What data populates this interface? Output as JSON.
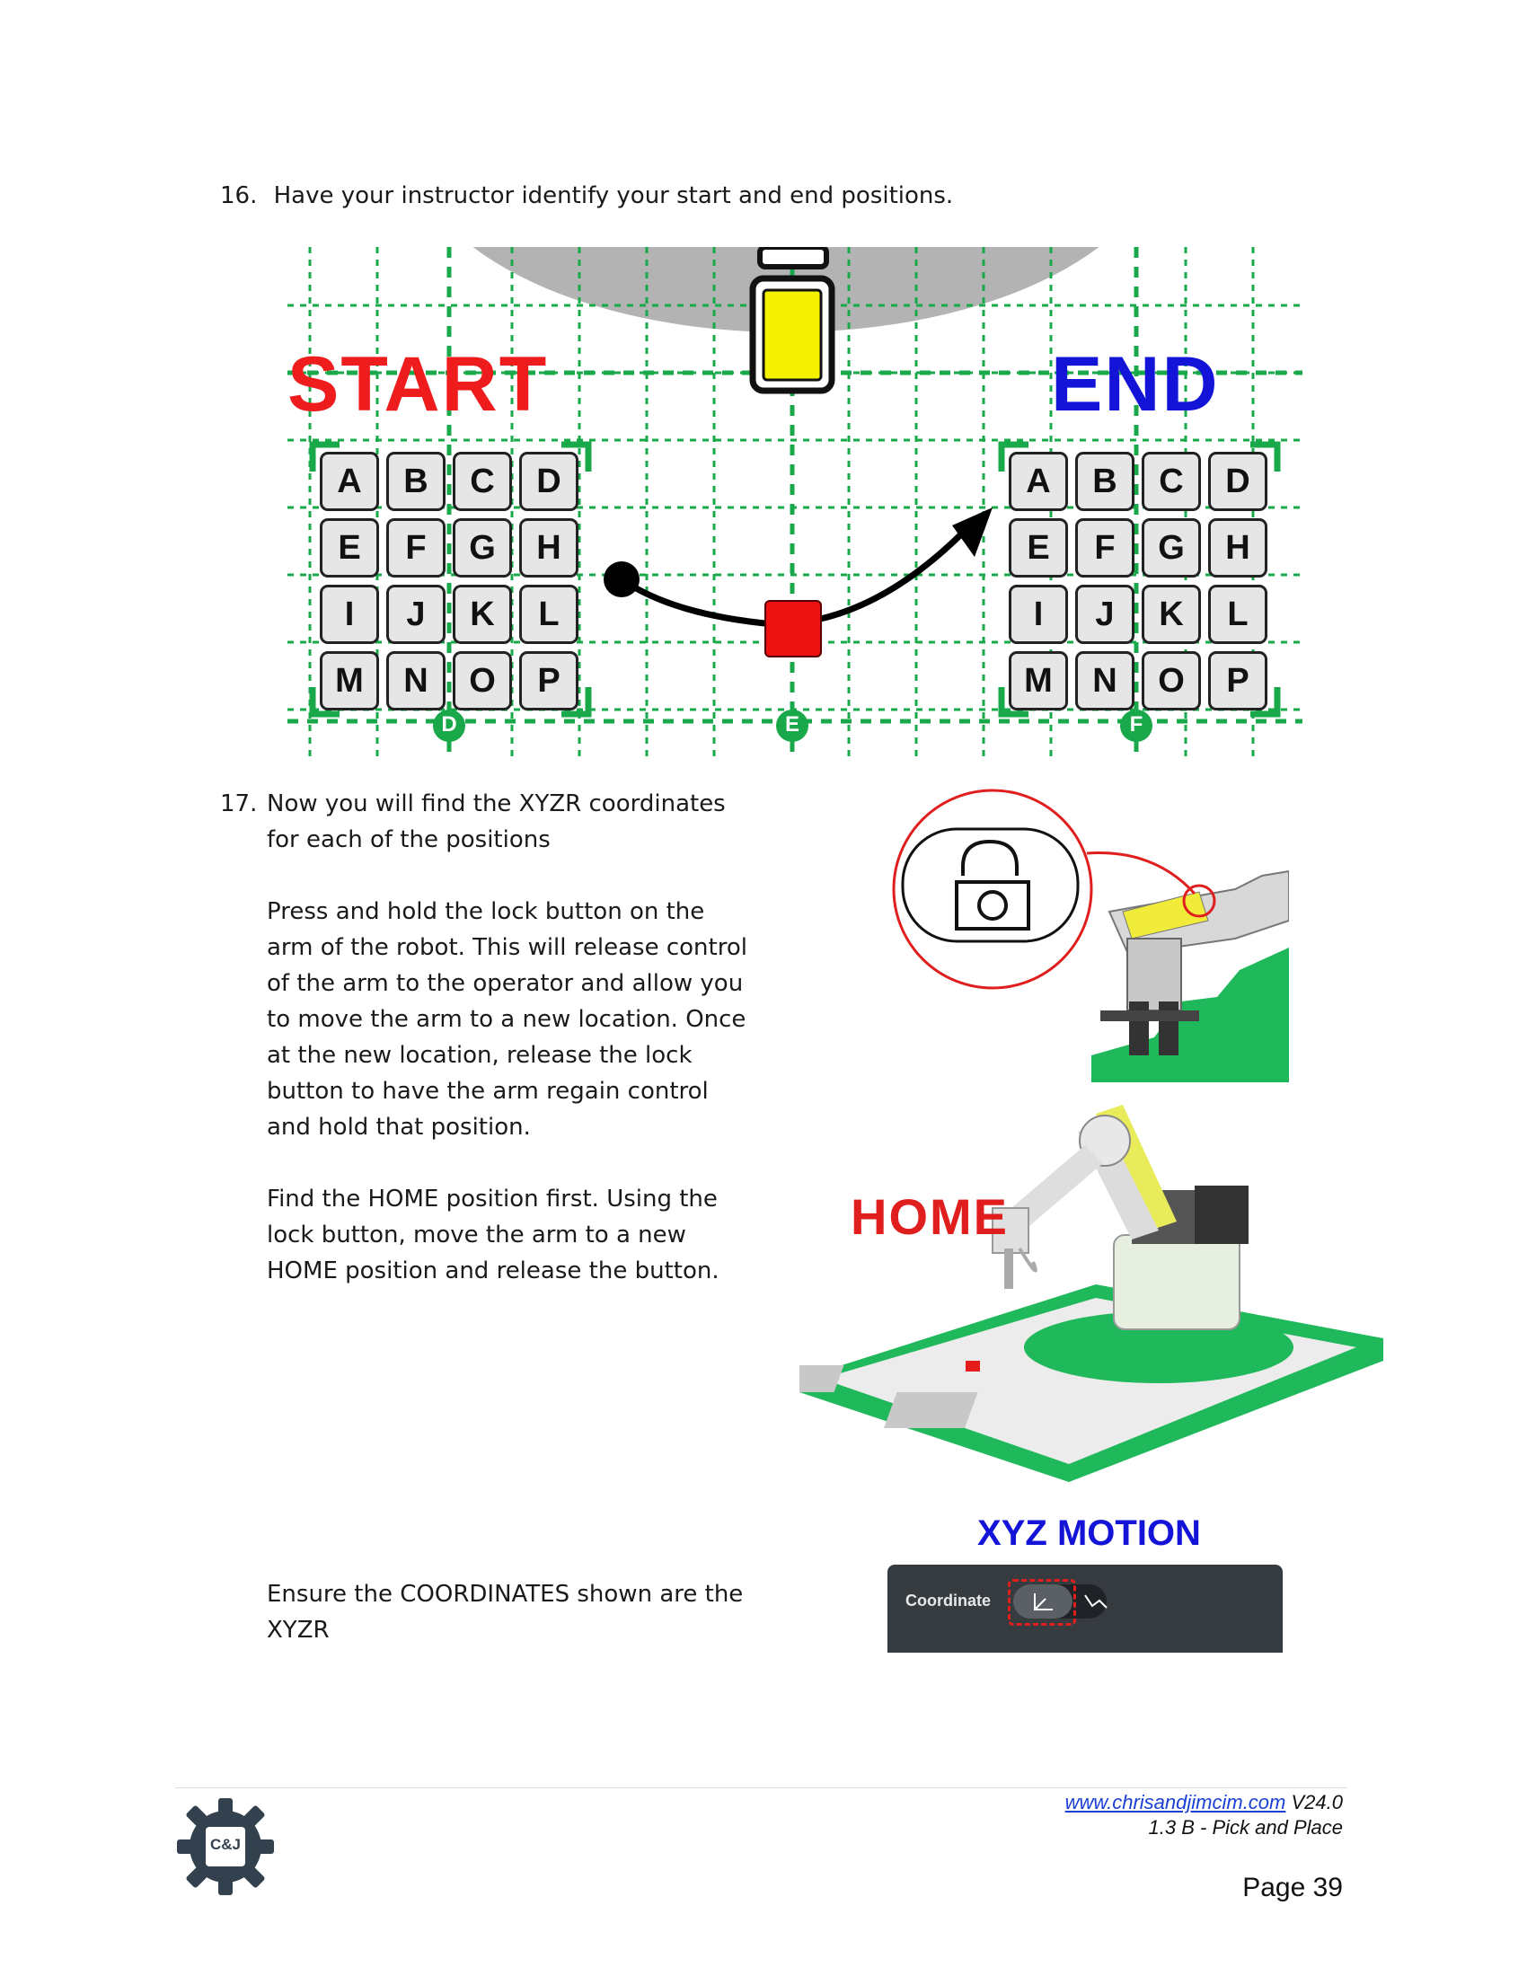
{
  "step16": {
    "number": "16.",
    "text": "Have your instructor identify your start and end positions."
  },
  "diagram": {
    "start_label": "START",
    "end_label": "END",
    "tiles": [
      "A",
      "B",
      "C",
      "D",
      "E",
      "F",
      "G",
      "H",
      "I",
      "J",
      "K",
      "L",
      "M",
      "N",
      "O",
      "P"
    ],
    "markers": [
      "D",
      "E",
      "F"
    ],
    "colors": {
      "start": "#ee1c1c",
      "end": "#1414d8",
      "grid": "#19a84a",
      "gripper": "#f4f200",
      "block": "#ee1111"
    }
  },
  "step17": {
    "number": "17.",
    "intro": "Now you will find the XYZR coordinates for each of the positions",
    "lock_text": "Press and hold the lock button on the arm of the robot.  This will release control of the arm to the operator and allow you to move the arm to a new location.  Once at the new location, release the lock button to have the arm regain control and hold that position.",
    "home_text": "Find the HOME position first. Using the lock button, move the arm to a new HOME position and release the button.",
    "coord_text": "Ensure the COORDINATES shown are the XYZR"
  },
  "home_image": {
    "label": "HOME"
  },
  "xyz_panel": {
    "title": "XYZ MOTION",
    "label": "Coordinate"
  },
  "footer": {
    "url": "www.chrisandjimcim.com",
    "version": "V24.0",
    "lesson": "1.3 B - Pick and Place",
    "page": "Page 39",
    "logo_text": "C&J"
  }
}
